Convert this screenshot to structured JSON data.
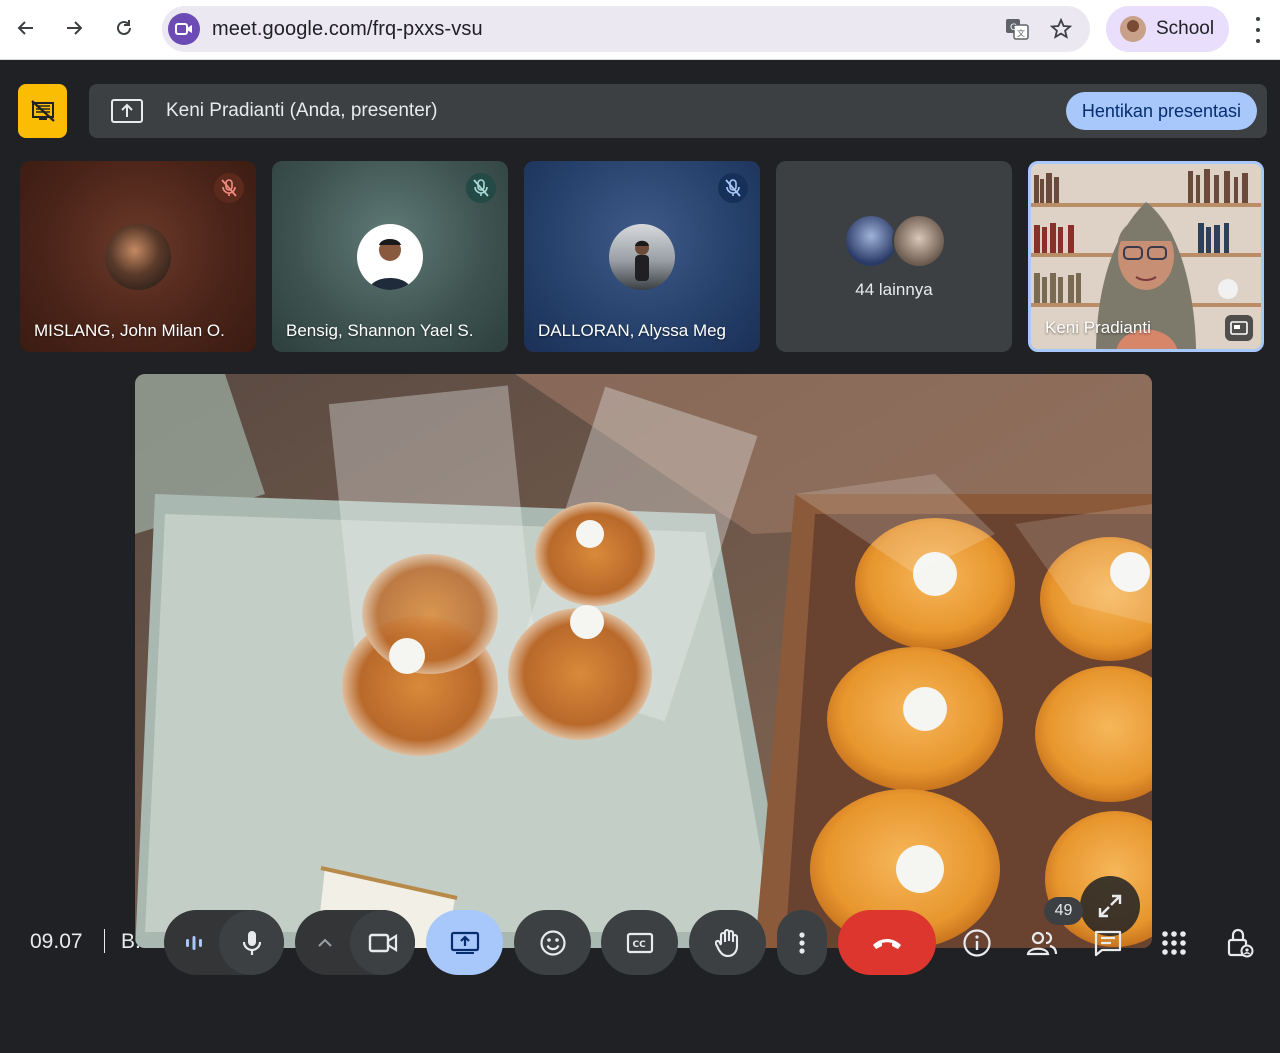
{
  "browser": {
    "url": "meet.google.com/frq-pxxs-vsu",
    "profile_label": "School",
    "icons": [
      "back-icon",
      "forward-icon",
      "reload-icon",
      "meet-site-icon",
      "translate-icon",
      "bookmark-star-icon",
      "more-vert-icon"
    ]
  },
  "presenting_bar": {
    "text": "Keni Pradianti (Anda, presenter)",
    "stop_label": "Hentikan presentasi"
  },
  "participants": [
    {
      "name": "MISLANG, John Milan O.",
      "muted": true
    },
    {
      "name": "Bensig, Shannon Yael S.",
      "muted": true
    },
    {
      "name": "DALLORAN, Alyssa Meg",
      "muted": true
    },
    {
      "name": "44 lainnya",
      "type": "overflow"
    },
    {
      "name": "Keni Pradianti",
      "self": true
    }
  ],
  "controls": {
    "time": "09.07",
    "meeting_code": "B.",
    "people_count": "49",
    "icons": [
      "audio-level-icon",
      "microphone-icon",
      "chevron-up-icon",
      "camera-icon",
      "present-screen-icon",
      "emoji-icon",
      "captions-icon",
      "raise-hand-icon",
      "more-vert-icon",
      "end-call-icon",
      "info-icon",
      "people-icon",
      "chat-icon",
      "apps-icon",
      "host-controls-icon"
    ]
  },
  "colors": {
    "background": "#202124",
    "accent_blue": "#a8c7fa",
    "present_yellow": "#fbbc04",
    "end_call_red": "#dc362e"
  }
}
